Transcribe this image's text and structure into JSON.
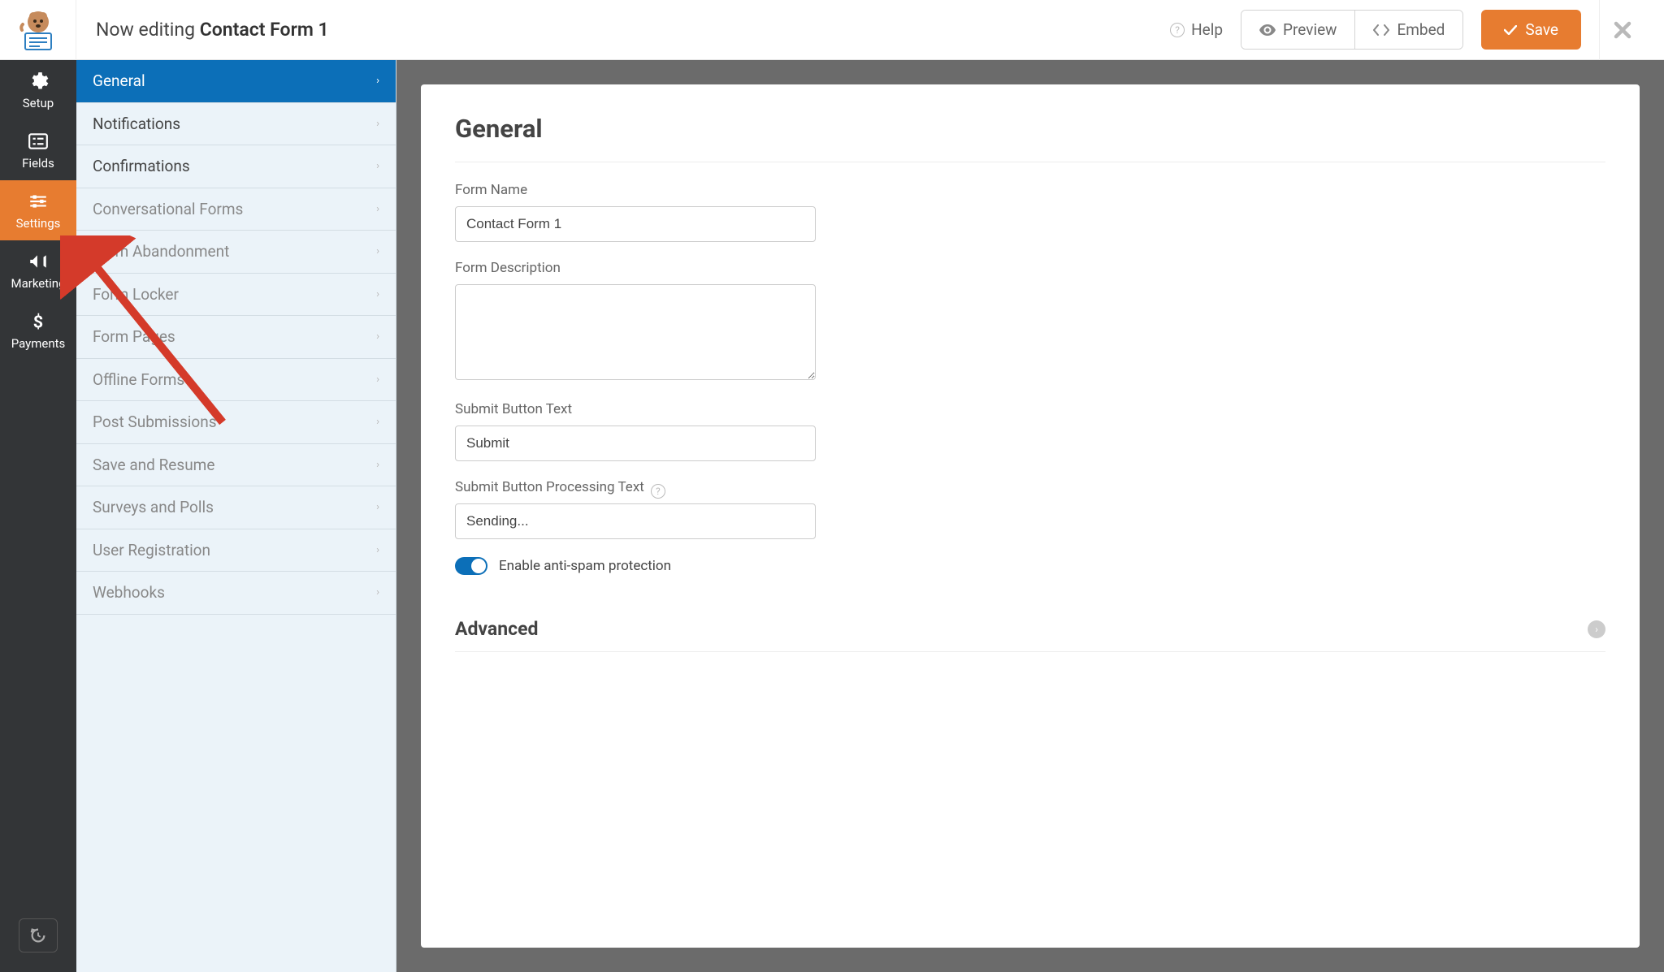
{
  "header": {
    "editing_prefix": "Now editing ",
    "form_name": "Contact Form 1",
    "help": "Help",
    "preview": "Preview",
    "embed": "Embed",
    "save": "Save"
  },
  "nav": {
    "setup": "Setup",
    "fields": "Fields",
    "settings": "Settings",
    "marketing": "Marketing",
    "payments": "Payments"
  },
  "settings_menu": {
    "general": "General",
    "notifications": "Notifications",
    "confirmations": "Confirmations",
    "conversational": "Conversational Forms",
    "abandonment": "Form Abandonment",
    "locker": "Form Locker",
    "pages": "Form Pages",
    "offline": "Offline Forms",
    "post": "Post Submissions",
    "save_resume": "Save and Resume",
    "surveys": "Surveys and Polls",
    "user_reg": "User Registration",
    "webhooks": "Webhooks"
  },
  "panel": {
    "heading": "General",
    "form_name_label": "Form Name",
    "form_name_value": "Contact Form 1",
    "form_desc_label": "Form Description",
    "form_desc_value": "",
    "submit_text_label": "Submit Button Text",
    "submit_text_value": "Submit",
    "processing_label": "Submit Button Processing Text",
    "processing_value": "Sending...",
    "antispam_label": "Enable anti-spam protection",
    "advanced": "Advanced"
  },
  "colors": {
    "accent": "#e77c30",
    "primary_blue": "#0c6fb8",
    "sidebar_bg": "#ebf3f9"
  }
}
